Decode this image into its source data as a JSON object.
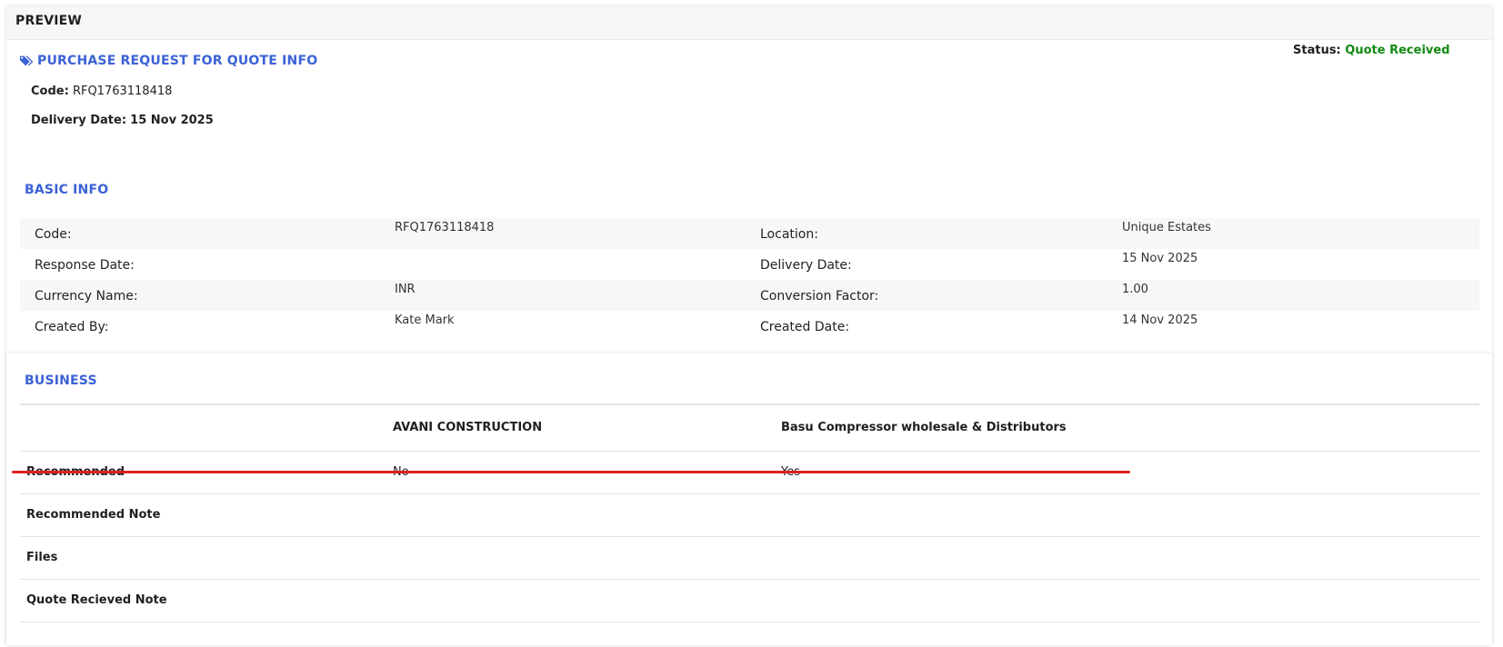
{
  "panel": {
    "title": "PREVIEW"
  },
  "rfq": {
    "section_title": "PURCHASE REQUEST FOR QUOTE INFO",
    "status_label": "Status:",
    "status_value": "Quote Received",
    "code_label": "Code:",
    "code_value": "RFQ1763118418",
    "delivery_label": "Delivery Date:",
    "delivery_value": "15 Nov 2025"
  },
  "basic_info": {
    "title": "BASIC INFO",
    "rows": [
      {
        "l1": "Code:",
        "v1": "RFQ1763118418",
        "l2": "Location:",
        "v2": "Unique Estates"
      },
      {
        "l1": "Response Date:",
        "v1": "",
        "l2": "Delivery Date:",
        "v2": "15 Nov 2025"
      },
      {
        "l1": "Currency Name:",
        "v1": "INR",
        "l2": "Conversion Factor:",
        "v2": "1.00"
      },
      {
        "l1": "Created By:",
        "v1": "Kate Mark",
        "l2": "Created Date:",
        "v2": "14 Nov 2025"
      }
    ]
  },
  "business": {
    "title": "BUSINESS",
    "columns": [
      "",
      "AVANI CONSTRUCTION",
      "Basu Compressor wholesale & Distributors"
    ],
    "rows": [
      {
        "label": "Recommended",
        "values": [
          "No",
          "Yes"
        ]
      },
      {
        "label": "Recommended Note",
        "values": [
          "",
          ""
        ]
      },
      {
        "label": "Files",
        "values": [
          "",
          ""
        ]
      },
      {
        "label": "Quote Recieved Note",
        "values": [
          "",
          ""
        ]
      }
    ]
  },
  "colors": {
    "accent": "#3b62d6",
    "status_ok": "#128a12",
    "annotation": "#e02020"
  }
}
